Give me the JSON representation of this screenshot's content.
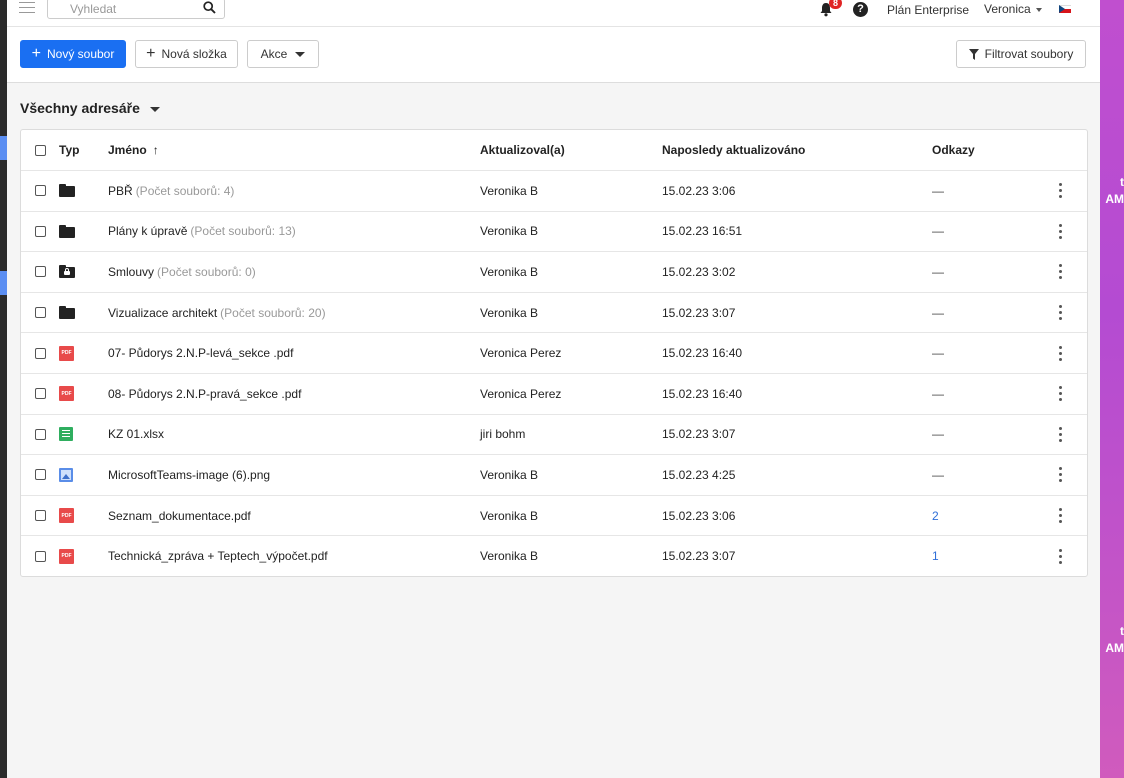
{
  "header": {
    "search_placeholder": "Vyhledat",
    "notifications_count": "8",
    "help_label": "?",
    "plan_label": "Plán Enterprise",
    "user_label": "Veronica"
  },
  "toolbar": {
    "new_file_label": "Nový soubor",
    "new_folder_label": "Nová složka",
    "actions_label": "Akce",
    "filter_label": "Filtrovat soubory"
  },
  "directory_selector": "Všechny adresáře",
  "table": {
    "columns": {
      "type": "Typ",
      "name": "Jméno",
      "updated_by": "Aktualizoval(a)",
      "updated_at": "Naposledy aktualizováno",
      "links": "Odkazy"
    },
    "rows": [
      {
        "type": "folder",
        "name": "PBŘ",
        "count": "(Počet souborů: 4)",
        "updated_by": "Veronika B",
        "updated_at": "15.02.23 3:06",
        "links": "—"
      },
      {
        "type": "folder",
        "name": "Plány k úpravě",
        "count": "(Počet souborů: 13)",
        "updated_by": "Veronika B",
        "updated_at": "15.02.23 16:51",
        "links": "—"
      },
      {
        "type": "folder-locked",
        "name": "Smlouvy",
        "count": "(Počet souborů: 0)",
        "updated_by": "Veronika B",
        "updated_at": "15.02.23 3:02",
        "links": "—"
      },
      {
        "type": "folder",
        "name": "Vizualizace architekt",
        "count": "(Počet souborů: 20)",
        "updated_by": "Veronika B",
        "updated_at": "15.02.23 3:07",
        "links": "—"
      },
      {
        "type": "pdf",
        "name": "07- Půdorys 2.N.P-levá_sekce .pdf",
        "count": "",
        "updated_by": "Veronica Perez",
        "updated_at": "15.02.23 16:40",
        "links": "—"
      },
      {
        "type": "pdf",
        "name": "08- Půdorys 2.N.P-pravá_sekce .pdf",
        "count": "",
        "updated_by": "Veronica Perez",
        "updated_at": "15.02.23 16:40",
        "links": "—"
      },
      {
        "type": "xlsx",
        "name": "KZ 01.xlsx",
        "count": "",
        "updated_by": "jiri bohm",
        "updated_at": "15.02.23 3:07",
        "links": "—"
      },
      {
        "type": "image",
        "name": "MicrosoftTeams-image (6).png",
        "count": "",
        "updated_by": "Veronika B",
        "updated_at": "15.02.23 4:25",
        "links": "—"
      },
      {
        "type": "pdf",
        "name": "Seznam_dokumentace.pdf",
        "count": "",
        "updated_by": "Veronika B",
        "updated_at": "15.02.23 3:06",
        "links": "2"
      },
      {
        "type": "pdf",
        "name": "Technická_zpráva + Teptech_výpočet.pdf",
        "count": "",
        "updated_by": "Veronika B",
        "updated_at": "15.02.23 3:07",
        "links": "1"
      }
    ]
  },
  "icons": {
    "pdf_label": "PDF"
  },
  "desktop": {
    "clock_fragment_1": "t",
    "clock_fragment_2": "AM",
    "clock_fragment_3": "t",
    "clock_fragment_4": "AM"
  },
  "colors": {
    "primary": "#1a6ff2",
    "link": "#2f6fd8",
    "pdf": "#e84a4a",
    "xlsx": "#2fae5f",
    "image": "#5a8de8"
  }
}
